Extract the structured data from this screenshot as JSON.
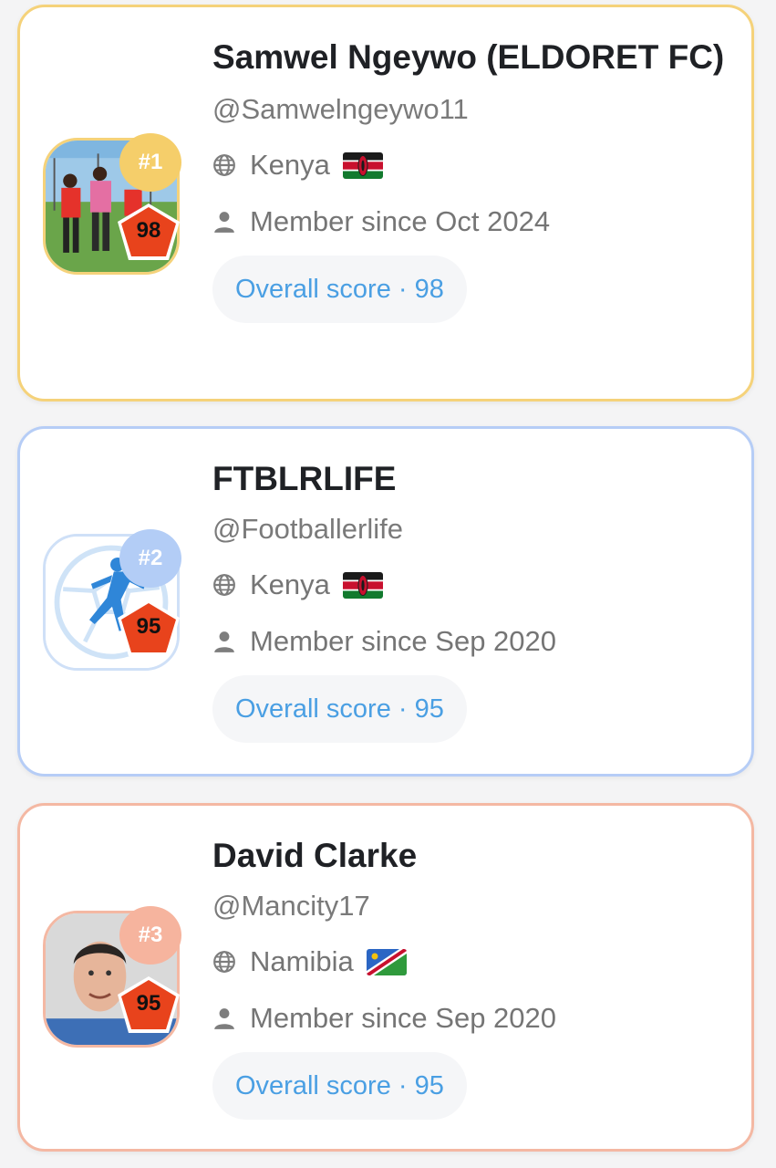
{
  "colors": {
    "gold": "#f5d27a",
    "blue": "#b6cdf6",
    "peach": "#f4b8a3",
    "score_accent": "#4a9fe3",
    "badge_red": "#e8431c"
  },
  "cards": [
    {
      "rank": "#1",
      "score_badge": "98",
      "name": "Samwel Ngeywo (ELDORET FC)",
      "handle": "@Samwelngeywo11",
      "country": "Kenya",
      "flag_icon": "kenya-flag-icon",
      "member_since": "Member since Oct 2024",
      "overall_score": "Overall score · 98"
    },
    {
      "rank": "#2",
      "score_badge": "95",
      "name": "FTBLRLIFE",
      "handle": "@Footballerlife",
      "country": "Kenya",
      "flag_icon": "kenya-flag-icon",
      "member_since": "Member since Sep 2020",
      "overall_score": "Overall score · 95"
    },
    {
      "rank": "#3",
      "score_badge": "95",
      "name": "David Clarke",
      "handle": "@Mancity17",
      "country": "Namibia",
      "flag_icon": "namibia-flag-icon",
      "member_since": "Member since Sep 2020",
      "overall_score": "Overall score · 95"
    }
  ]
}
